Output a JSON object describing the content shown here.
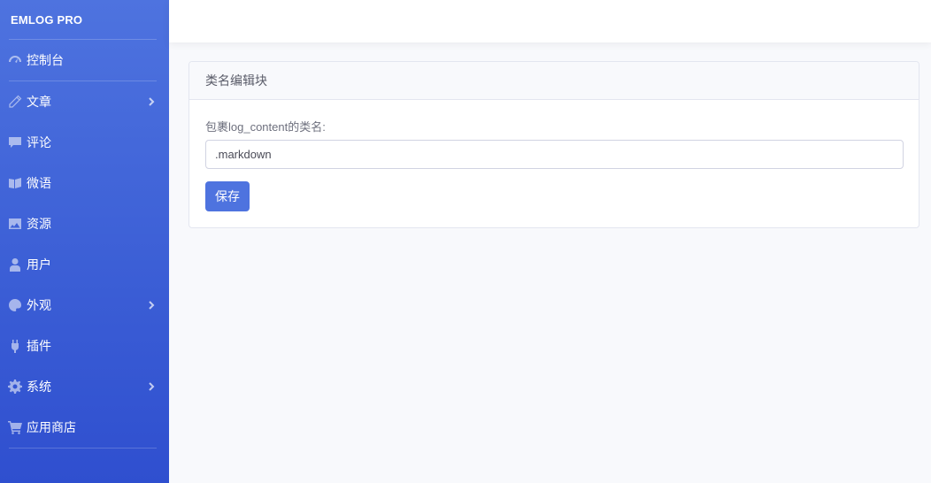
{
  "brand": "EMLOG PRO",
  "sidebar": {
    "items": [
      {
        "label": "控制台",
        "icon": "dashboard-icon",
        "has_submenu": false
      },
      {
        "label": "文章",
        "icon": "pencil-icon",
        "has_submenu": true
      },
      {
        "label": "评论",
        "icon": "comment-icon",
        "has_submenu": false
      },
      {
        "label": "微语",
        "icon": "notes-icon",
        "has_submenu": false
      },
      {
        "label": "资源",
        "icon": "image-icon",
        "has_submenu": false
      },
      {
        "label": "用户",
        "icon": "user-icon",
        "has_submenu": false
      },
      {
        "label": "外观",
        "icon": "palette-icon",
        "has_submenu": true
      },
      {
        "label": "插件",
        "icon": "plug-icon",
        "has_submenu": false
      },
      {
        "label": "系统",
        "icon": "gear-icon",
        "has_submenu": true
      },
      {
        "label": "应用商店",
        "icon": "cart-icon",
        "has_submenu": false
      }
    ]
  },
  "card": {
    "title": "类名编辑块",
    "field_label": "包裹log_content的类名:",
    "field_value": ".markdown",
    "save_label": "保存"
  },
  "colors": {
    "primary": "#4e73df",
    "sidebar_bottom": "#2f4fcf",
    "page_bg": "#f8f9fc"
  }
}
